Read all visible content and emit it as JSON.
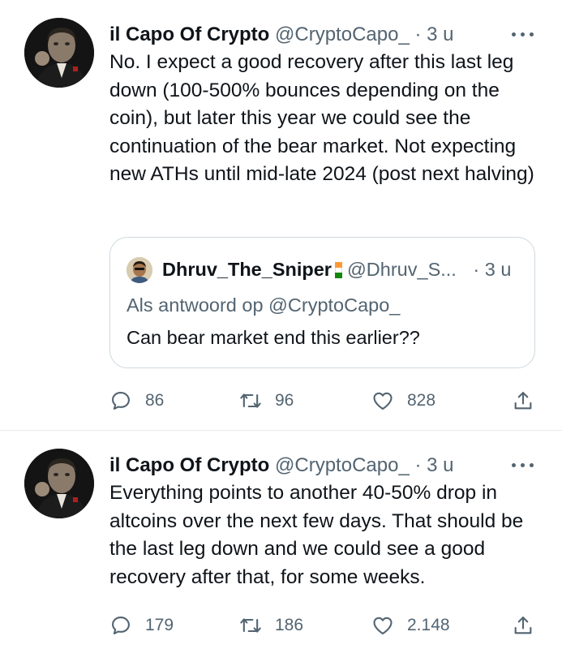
{
  "tweets": [
    {
      "author_name": "il Capo Of Crypto",
      "author_handle": "@CryptoCapo_",
      "separator": "·",
      "time": "3 u",
      "text": "No. I expect a good recovery after this last leg down (100-500% bounces depending on the coin), but later this year we could see the continuation of the bear market. Not expecting new ATHs until mid-late 2024 (post next halving)",
      "quote": {
        "author_name": "Dhruv_The_Sniper",
        "author_handle": "@Dhruv_S...",
        "separator": "·",
        "time": "3 u",
        "reply_to": "Als antwoord op @CryptoCapo_",
        "text": "Can bear market end this earlier??"
      },
      "replies": "86",
      "retweets": "96",
      "likes": "828"
    },
    {
      "author_name": "il Capo Of Crypto",
      "author_handle": "@CryptoCapo_",
      "separator": "·",
      "time": "3 u",
      "text": "Everything points to another 40-50% drop in altcoins over the next few days. That should be the last leg down and we could see a good recovery after that, for some weeks.",
      "replies": "179",
      "retweets": "186",
      "likes": "2.148"
    }
  ],
  "colors": {
    "text_primary": "#0f1419",
    "text_secondary": "#536471",
    "border": "#cfd9de",
    "divider": "#e7ecf0",
    "flag_saffron": "#ff9933",
    "flag_white": "#ffffff",
    "flag_green": "#138808"
  },
  "icons": {
    "reply": "speech-bubble-icon",
    "retweet": "retweet-arrows-icon",
    "like": "heart-outline-icon",
    "share": "share-upload-icon",
    "more": "ellipsis-icon"
  }
}
